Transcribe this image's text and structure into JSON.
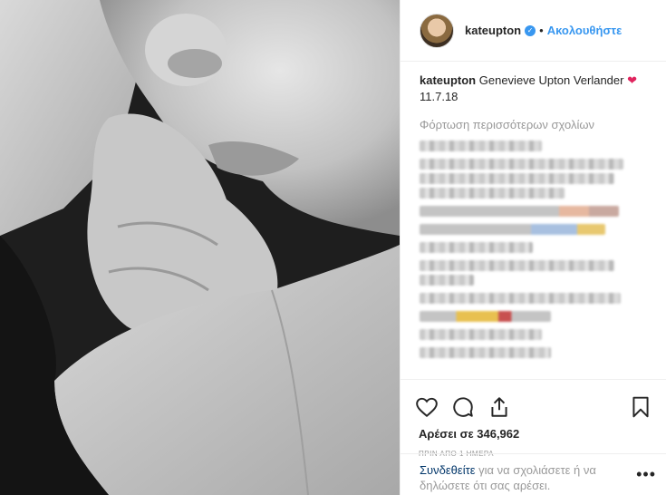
{
  "post": {
    "username": "kateupton",
    "follow_label": "Ακολουθήστε",
    "dot": "•",
    "caption_user": "kateupton",
    "caption_text": "Genevieve Upton Verlander",
    "caption_emoji": "❤",
    "caption_date": "11.7.18",
    "load_more": "Φόρτωση περισσότερων σχολίων",
    "likes": "Αρέσει σε 346,962",
    "time": "ΠΡΙΝ ΑΠΟ 1 ΗΜΕΡΑ",
    "login_link": "Συνδεθείτε",
    "login_rest": "για να σχολιάσετε ή να δηλώσετε ότι σας αρέσει.",
    "more_glyph": "•••",
    "verified_glyph": "✓"
  },
  "icons": {
    "like": "heart-icon",
    "comment": "comment-icon",
    "share": "share-icon",
    "save": "bookmark-icon"
  },
  "colors": {
    "accent": "#3897f0",
    "link": "#003569",
    "heart": "#e0245e"
  }
}
